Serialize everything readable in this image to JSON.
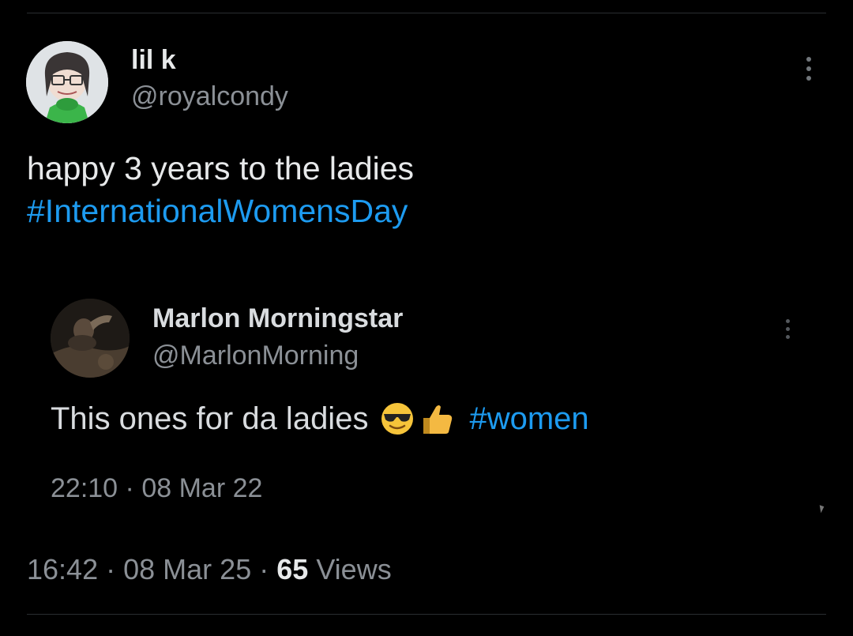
{
  "tweet": {
    "display_name": "lil k",
    "handle": "@royalcondy",
    "text": "happy 3 years to the ladies",
    "hashtag": "#InternationalWomensDay",
    "time": "16:42",
    "date": "08 Mar 25",
    "views_count": "65",
    "views_label": "Views",
    "separator": "·"
  },
  "quoted": {
    "display_name": "Marlon Morningstar",
    "handle": "@MarlonMorning",
    "text": "This ones for da ladies",
    "emojis": [
      "smiling-face-with-sunglasses",
      "thumbs-up"
    ],
    "hashtag": "#women",
    "time": "22:10",
    "date": "08 Mar 22",
    "separator": "·"
  },
  "colors": {
    "background": "#000000",
    "text": "#e7e9ea",
    "muted": "#8b9096",
    "link": "#1d9bf0"
  }
}
